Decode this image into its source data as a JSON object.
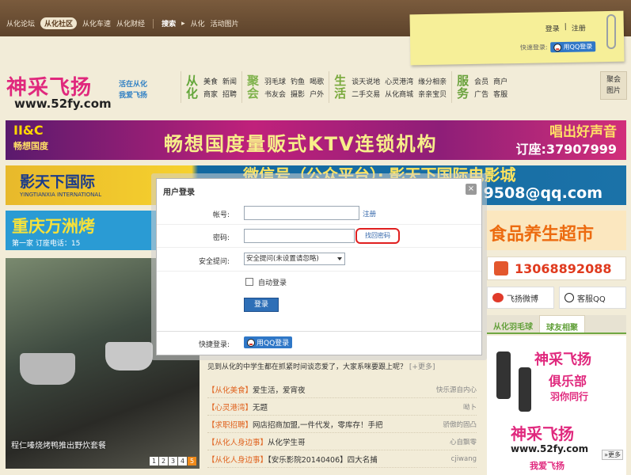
{
  "topnav": {
    "links": [
      "从化论坛",
      "从化社区",
      "从化车速",
      "从化财经"
    ],
    "active": "从化社区",
    "search_label": "搜索",
    "search_arrow": "▸",
    "search_sub": [
      "从化",
      "活动图片"
    ]
  },
  "userbar": {
    "login": "登录",
    "sep": "|",
    "register": "注册",
    "quick_login": "快速登录:",
    "qq_login": "用QQ登录"
  },
  "logo": {
    "brand": "神采飞扬",
    "slogan_1": "活在从化",
    "slogan_2": "我爱飞扬",
    "url": "www.52fy.com"
  },
  "nav": {
    "groups": [
      {
        "title": "从化",
        "items": [
          "美食",
          "商家",
          "新闻",
          "招聘"
        ]
      },
      {
        "title": "聚会",
        "items": [
          "羽毛球",
          "书友会",
          "钓鱼",
          "摄影",
          "喝歌",
          "户外"
        ]
      },
      {
        "title": "生活",
        "items": [
          "谈天说地",
          "二手交易",
          "心灵港湾",
          "从化商城",
          "缘分相亲",
          "亲亲宝贝"
        ]
      },
      {
        "title": "服务",
        "items": [
          "会员",
          "广告",
          "商户",
          "客服"
        ]
      }
    ],
    "box": [
      "聚会",
      "图片"
    ]
  },
  "banners": {
    "b1_logo": "II&C",
    "b1_logo_sub": "畅想国度",
    "b1_text": "畅想国度量贩式KTV连锁机构",
    "b1_right": "唱出好声音",
    "b1_phone": "订座:37907999",
    "b2_left": "影天下国际",
    "b2_left_sub": "YINGTIANXIA INTERNATIONAL",
    "b2_mid": "微信号（公众平台）· 影天下国际电影城",
    "b2_email": "9508@qq.com",
    "b3_text": "重庆万洲烤",
    "b3_sub": "第一家    订座电话：15",
    "b3b_text": "食品养生超市"
  },
  "photo": {
    "caption": "程仁嗪烧烤鸭推出野炊套餐",
    "pages": [
      "1",
      "2",
      "3",
      "4",
      "5"
    ],
    "current": "5"
  },
  "sidebar": {
    "phone": "13068892088",
    "weibo": "飞扬微博",
    "service_qq": "客服QQ",
    "tabs": [
      "从化羽毛球",
      "球友相聚"
    ],
    "ad_lines": [
      "神采飞扬",
      "俱乐部",
      "羽你同行",
      "神采飞扬",
      "www.52fy.com",
      "我爱飞扬"
    ],
    "more": "»更多"
  },
  "news": {
    "intro": "见到从化的中学生都在抓紧时间谈恋爱了，大家系咪要跟上呢？",
    "intro_more": "[+更多]",
    "rows": [
      {
        "tag": "【从化美食】",
        "title": "爱生活，爱宵夜",
        "author": "快乐源自内心"
      },
      {
        "tag": "【心灵港湾】",
        "title": "无题",
        "author": "呦卜"
      },
      {
        "tag": "【求职招聘】",
        "title": "网店招商加盟,一件代发，零库存！手把",
        "author": "骄傲的固凸"
      },
      {
        "tag": "【从化人身边事】",
        "title": "从化学生哥",
        "author": "心自飘零"
      },
      {
        "tag": "【从化人身边事】",
        "title": "【安乐影院20140406】四大名捕",
        "author": "cjiwang"
      }
    ]
  },
  "dialog": {
    "title": "用户登录",
    "close": "×",
    "account_label": "帐号:",
    "register_link": "注册",
    "password_label": "密码:",
    "find_password": "找回密码",
    "security_label": "安全提问:",
    "security_value": "安全提问(未设置请忽略)",
    "auto_login": "自动登录",
    "submit": "登录",
    "quick_label": "快捷登录:",
    "qq_login": "用QQ登录"
  }
}
